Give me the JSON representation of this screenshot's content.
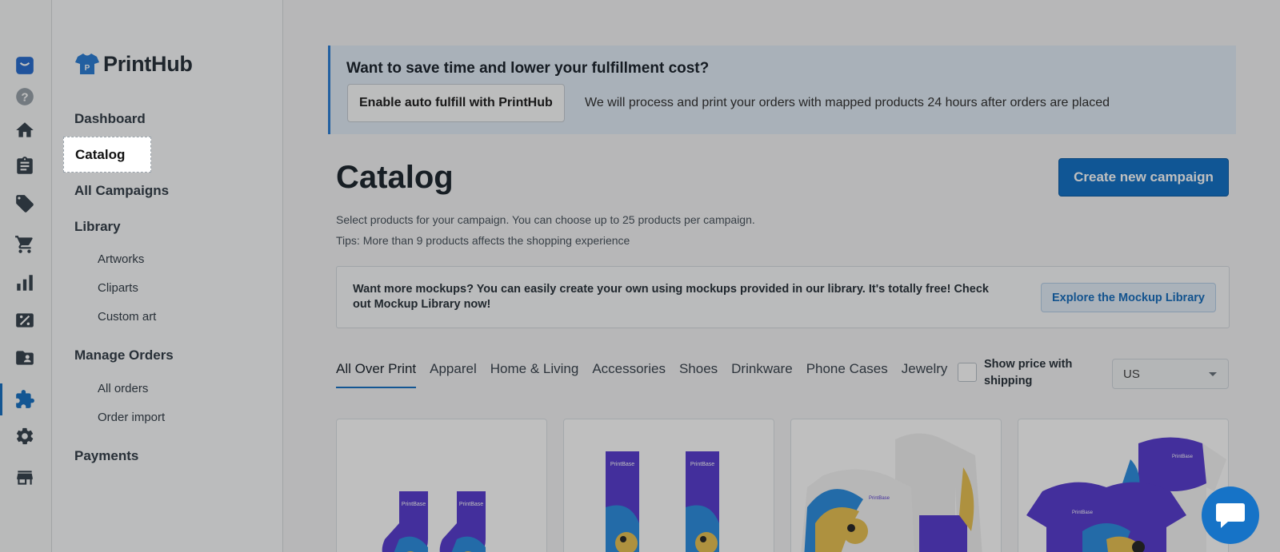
{
  "brand": {
    "name": "PrintHub",
    "accent": "#1673c7"
  },
  "rail": {
    "icons": [
      "store-bag-icon",
      "help-icon",
      "home-icon",
      "clipboard-icon",
      "tags-icon",
      "cart-icon",
      "analytics-icon",
      "discount-icon",
      "contacts-icon",
      "puzzle-icon",
      "settings-icon",
      "storefront-icon"
    ],
    "active": "puzzle-icon"
  },
  "sidebar": {
    "dashboard": "Dashboard",
    "catalog": "Catalog",
    "all_campaigns": "All Campaigns",
    "library": "Library",
    "library_items": [
      "Artworks",
      "Cliparts",
      "Custom art"
    ],
    "manage_orders": "Manage Orders",
    "order_items": [
      "All orders",
      "Order import"
    ],
    "payments": "Payments"
  },
  "banner": {
    "title": "Want to save time and lower your fulfillment cost?",
    "button": "Enable auto fulfill with PrintHub",
    "text": "We will process and print your orders with mapped products 24 hours after orders are placed"
  },
  "page": {
    "title": "Catalog",
    "create_button": "Create new campaign",
    "desc1": "Select products for your campaign. You can choose up to 25 products per campaign.",
    "desc2": "Tips: More than 9 products affects the shopping experience"
  },
  "mockup": {
    "text": "Want more mockups? You can easily create your own using mockups provided in our library. It's totally free! Check out Mockup Library now!",
    "button": "Explore the Mockup Library"
  },
  "tabs": [
    "All Over Print",
    "Apparel",
    "Home & Living",
    "Accessories",
    "Shoes",
    "Drinkware",
    "Phone Cases",
    "Jewelry"
  ],
  "active_tab": "All Over Print",
  "filters": {
    "show_price_label": "Show price with shipping",
    "show_price_checked": false,
    "country": "US"
  },
  "products": [
    {
      "type": "socks-ankle",
      "brand": "PrintBase"
    },
    {
      "type": "socks-crew",
      "brand": "PrintBase"
    },
    {
      "type": "long-sleeve-tee",
      "brand": "PrintBase"
    },
    {
      "type": "tee",
      "brand": "PrintBase"
    }
  ]
}
